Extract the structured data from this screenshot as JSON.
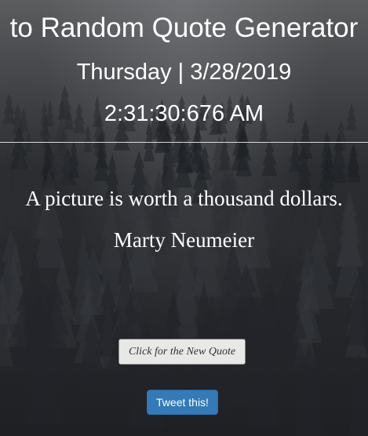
{
  "header": {
    "title": "to Random Quote Generator",
    "date": "Thursday | 3/28/2019",
    "time": "2:31:30:676 AM"
  },
  "quote": {
    "text": "A picture is worth a thousand dollars.",
    "author": "Marty Neumeier"
  },
  "buttons": {
    "new_quote_label": "Click for the New Quote",
    "tweet_label": "Tweet this!"
  },
  "colors": {
    "text": "#ffffff",
    "tweet_button": "#337ab7",
    "new_quote_button": "#e8e8e6"
  }
}
